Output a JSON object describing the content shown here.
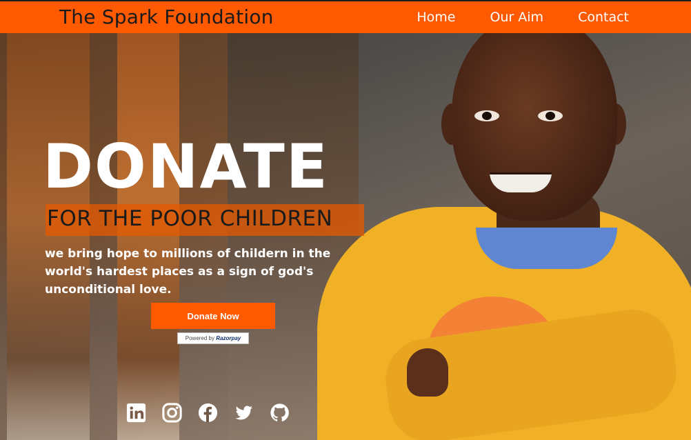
{
  "header": {
    "brand": "The Spark Foundation",
    "nav": [
      "Home",
      "Our Aim",
      "Contact"
    ]
  },
  "hero": {
    "title": "DONATE",
    "subtitle": "FOR THE POOR CHILDREN",
    "tagline": "we bring hope to millions of childern in the world's hardest places as a sign of god's unconditional love.",
    "donate_button": "Donate Now",
    "powered_by_prefix": "Powered by",
    "powered_by_brand": "Razorpay"
  },
  "social": [
    "linkedin-icon",
    "instagram-icon",
    "facebook-icon",
    "twitter-icon",
    "github-icon"
  ],
  "colors": {
    "accent": "#ff5a00",
    "text_light": "#ffffff",
    "text_dark": "#1b1b1b"
  }
}
